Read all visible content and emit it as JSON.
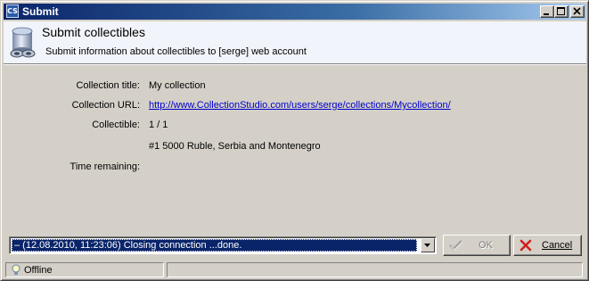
{
  "window": {
    "app_icon": "CS",
    "title": "Submit",
    "controls": [
      "minimize-icon",
      "maximize-icon",
      "close-icon"
    ]
  },
  "header": {
    "icon": "database-icon",
    "title": "Submit collectibles",
    "subtitle": "Submit information about collectibles to [serge] web account"
  },
  "details": {
    "collection_title_label": "Collection title:",
    "collection_title_value": "My collection",
    "collection_url_label": "Collection URL:",
    "collection_url_value": "http://www.CollectionStudio.com/users/serge/collections/Mycollection/",
    "collectible_label": "Collectible:",
    "collectible_value": "1 / 1",
    "collectible_name": "#1 5000 Ruble, Serbia and Montenegro",
    "time_remaining_label": "Time remaining:",
    "time_remaining_value": ""
  },
  "log": {
    "selected": "–  (12.08.2010, 11:23:06) Closing connection ...done."
  },
  "buttons": {
    "ok_label": "OK",
    "ok_icon": "checkmark-icon",
    "cancel_label": "Cancel",
    "cancel_icon": "x-icon"
  },
  "status": {
    "icon": "lightbulb-icon",
    "connection": "Offline"
  },
  "colors": {
    "title_gradient_start": "#0a246a",
    "title_gradient_end": "#a6caf0",
    "link": "#0000cc",
    "selection": "#0a246a",
    "cancel_x": "#d02020"
  }
}
